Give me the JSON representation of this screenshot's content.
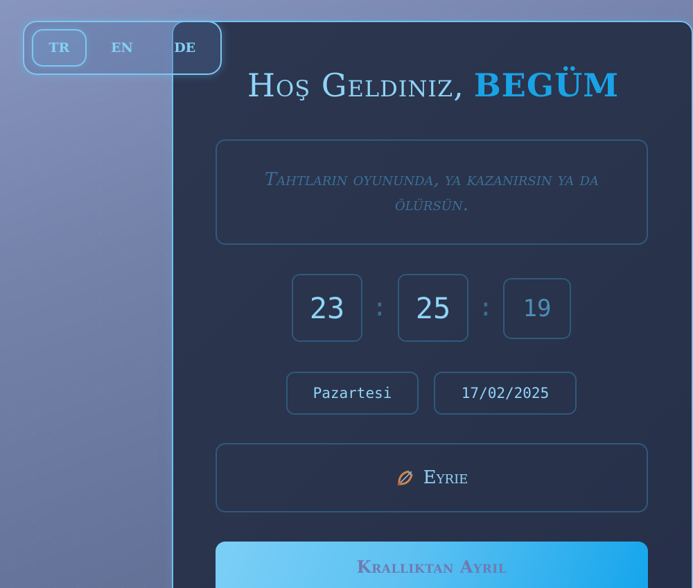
{
  "language_switcher": {
    "options": [
      "TR",
      "EN",
      "DE"
    ],
    "active": "TR"
  },
  "welcome": {
    "greeting": "Hoş Geldiniz,",
    "name": "BEGÜM"
  },
  "quote": "Tahtların oyununda, ya kazanırsın ya da ölürsün.",
  "clock": {
    "hours": "23",
    "minutes": "25",
    "seconds": "19",
    "separator": ":"
  },
  "date_info": {
    "weekday": "Pazartesi",
    "date": "17/02/2025"
  },
  "house": {
    "icon": "bow-and-arrow-icon",
    "label": "Eyrie"
  },
  "actions": {
    "leave_label": "Krallıktan Ayrıl"
  },
  "colors": {
    "accent": "#19a3e6",
    "text": "#8fd4f7",
    "border": "#6fc1ee",
    "card_bg": "#2a344c"
  }
}
